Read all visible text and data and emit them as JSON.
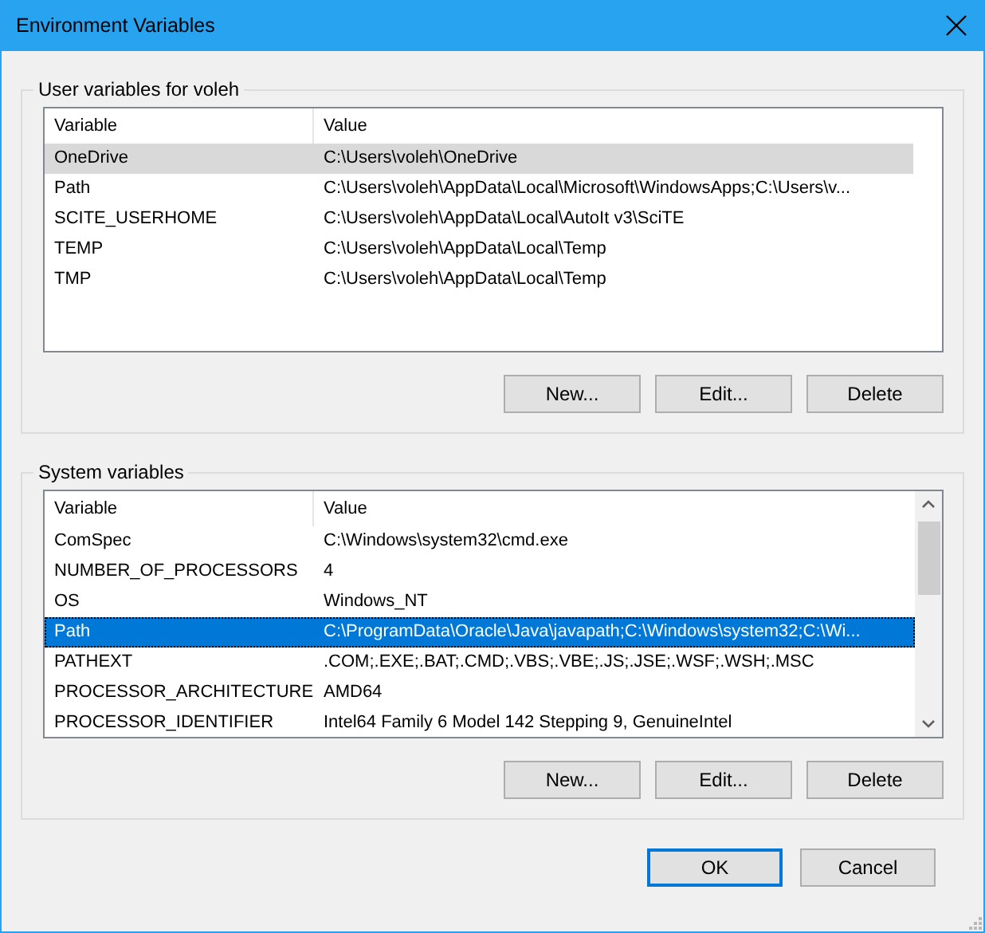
{
  "window": {
    "title": "Environment Variables"
  },
  "groups": [
    {
      "title": "User variables for voleh",
      "focused": false,
      "scrollbar": false,
      "columns": [
        "Variable",
        "Value"
      ],
      "rows": [
        {
          "variable": "OneDrive",
          "value": "C:\\Users\\voleh\\OneDrive",
          "selected": true
        },
        {
          "variable": "Path",
          "value": "C:\\Users\\voleh\\AppData\\Local\\Microsoft\\WindowsApps;C:\\Users\\v...",
          "selected": false
        },
        {
          "variable": "SCITE_USERHOME",
          "value": "C:\\Users\\voleh\\AppData\\Local\\AutoIt v3\\SciTE",
          "selected": false
        },
        {
          "variable": "TEMP",
          "value": "C:\\Users\\voleh\\AppData\\Local\\Temp",
          "selected": false
        },
        {
          "variable": "TMP",
          "value": "C:\\Users\\voleh\\AppData\\Local\\Temp",
          "selected": false
        }
      ],
      "buttons": [
        "New...",
        "Edit...",
        "Delete"
      ]
    },
    {
      "title": "System variables",
      "focused": true,
      "scrollbar": true,
      "columns": [
        "Variable",
        "Value"
      ],
      "rows": [
        {
          "variable": "ComSpec",
          "value": "C:\\Windows\\system32\\cmd.exe",
          "selected": false
        },
        {
          "variable": "NUMBER_OF_PROCESSORS",
          "value": "4",
          "selected": false
        },
        {
          "variable": "OS",
          "value": "Windows_NT",
          "selected": false
        },
        {
          "variable": "Path",
          "value": "C:\\ProgramData\\Oracle\\Java\\javapath;C:\\Windows\\system32;C:\\Wi...",
          "selected": true
        },
        {
          "variable": "PATHEXT",
          "value": ".COM;.EXE;.BAT;.CMD;.VBS;.VBE;.JS;.JSE;.WSF;.WSH;.MSC",
          "selected": false
        },
        {
          "variable": "PROCESSOR_ARCHITECTURE",
          "value": "AMD64",
          "selected": false
        },
        {
          "variable": "PROCESSOR_IDENTIFIER",
          "value": "Intel64 Family 6 Model 142 Stepping 9, GenuineIntel",
          "selected": false
        }
      ],
      "buttons": [
        "New...",
        "Edit...",
        "Delete"
      ]
    }
  ],
  "footer_buttons": [
    {
      "label": "OK",
      "default": true
    },
    {
      "label": "Cancel",
      "default": false
    }
  ]
}
